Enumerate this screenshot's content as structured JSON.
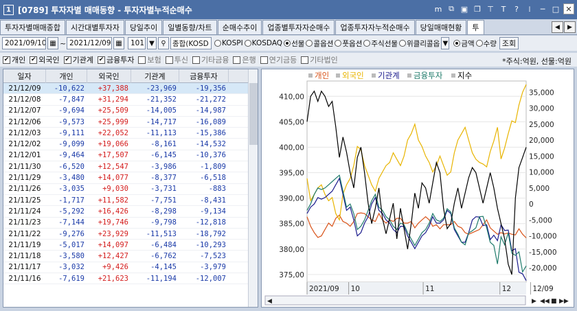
{
  "window": {
    "number": "1",
    "title": "[0789] 투자자별 매매동향 - 투자자별누적순매수"
  },
  "tabs": [
    "투자자별매매종합",
    "시간대별투자자",
    "당일추이",
    "일별동향/차트",
    "순매수추이",
    "업종별투자자순매수",
    "업종투자자누적순매수",
    "당일매매현황",
    "투"
  ],
  "toolbar": {
    "from_date": "2021/09/10",
    "to_date": "2021/12/09",
    "sep": "~",
    "code": "101",
    "market": "종합(KOSD",
    "options": [
      "KOSPI",
      "KOSDAQ",
      "선물",
      "콜옵션",
      "풋옵션",
      "주식선물",
      "위클리콜옵"
    ],
    "selected_option": "선물",
    "mode": [
      "금액",
      "수량"
    ],
    "selected_mode": "금액",
    "query_button": "조회"
  },
  "filters": [
    {
      "label": "개인",
      "checked": true
    },
    {
      "label": "외국인",
      "checked": true
    },
    {
      "label": "기관계",
      "checked": true
    },
    {
      "label": "금융투자",
      "checked": true
    },
    {
      "label": "보험",
      "checked": false
    },
    {
      "label": "투신",
      "checked": false
    },
    {
      "label": "기타금융",
      "checked": false
    },
    {
      "label": "은행",
      "checked": false
    },
    {
      "label": "연기금등",
      "checked": false
    },
    {
      "label": "기타법인",
      "checked": false
    }
  ],
  "unit_note": "*주식:억원, 선물:억원",
  "table": {
    "columns": [
      "일자",
      "개인",
      "외국인",
      "기관계",
      "금융투자"
    ],
    "rows": [
      [
        "21/12/09",
        "-10,622",
        "+37,388",
        "-23,969",
        "-19,356"
      ],
      [
        "21/12/08",
        "-7,847",
        "+31,294",
        "-21,352",
        "-21,272"
      ],
      [
        "21/12/07",
        "-9,694",
        "+25,509",
        "-14,005",
        "-14,987"
      ],
      [
        "21/12/06",
        "-9,573",
        "+25,999",
        "-14,717",
        "-16,089"
      ],
      [
        "21/12/03",
        "-9,111",
        "+22,052",
        "-11,113",
        "-15,386"
      ],
      [
        "21/12/02",
        "-9,099",
        "+19,066",
        "-8,161",
        "-14,532"
      ],
      [
        "21/12/01",
        "-9,464",
        "+17,507",
        "-6,145",
        "-10,376"
      ],
      [
        "21/11/30",
        "-6,520",
        "+12,547",
        "-3,986",
        "-1,809"
      ],
      [
        "21/11/29",
        "-3,480",
        "+14,077",
        "-8,377",
        "-6,518"
      ],
      [
        "21/11/26",
        "-3,035",
        "+9,030",
        "-3,731",
        "-883"
      ],
      [
        "21/11/25",
        "-1,717",
        "+11,582",
        "-7,751",
        "-8,431"
      ],
      [
        "21/11/24",
        "-5,292",
        "+16,426",
        "-8,298",
        "-9,134"
      ],
      [
        "21/11/23",
        "-7,144",
        "+19,746",
        "-9,798",
        "-12,818"
      ],
      [
        "21/11/22",
        "-9,276",
        "+23,929",
        "-11,513",
        "-18,792"
      ],
      [
        "21/11/19",
        "-5,017",
        "+14,097",
        "-6,484",
        "-10,293"
      ],
      [
        "21/11/18",
        "-3,580",
        "+12,427",
        "-6,762",
        "-7,523"
      ],
      [
        "21/11/17",
        "-3,032",
        "+9,426",
        "-4,145",
        "-3,979"
      ],
      [
        "21/11/16",
        "-7,619",
        "+21,623",
        "-11,194",
        "-12,007"
      ]
    ]
  },
  "chart_data": {
    "type": "line",
    "legend": [
      {
        "name": "개인",
        "color": "#d9541a"
      },
      {
        "name": "외국인",
        "color": "#e8b400"
      },
      {
        "name": "기관계",
        "color": "#1a1a8c"
      },
      {
        "name": "금융투자",
        "color": "#1e7a6a"
      },
      {
        "name": "지수",
        "color": "#000000"
      }
    ],
    "left_axis": {
      "ticks": [
        "410,00",
        "405,00",
        "400,00",
        "395,00",
        "390,00",
        "385,00",
        "380,00",
        "375,00"
      ],
      "range": [
        373.5,
        413
      ]
    },
    "right_axis": {
      "ticks": [
        "35,000",
        "30,000",
        "25,000",
        "20,000",
        "15,000",
        "10,000",
        "5,000",
        "0",
        "-5,000",
        "-10,000",
        "-15,000",
        "-20,000"
      ],
      "range": [
        -24500,
        38500
      ]
    },
    "x_labels": [
      "2021/09",
      "10",
      "11",
      "12",
      "12/09"
    ],
    "n_points": 62,
    "series_kospi200": [
      405,
      410,
      411,
      409,
      411,
      410,
      408,
      409,
      404,
      398,
      402,
      399,
      395,
      392,
      398,
      400,
      395,
      389,
      385,
      388,
      392,
      386,
      383,
      386,
      389,
      382,
      388,
      384,
      380,
      385,
      391,
      388,
      393,
      392,
      389,
      393,
      397,
      395,
      388,
      384,
      385,
      389,
      392,
      388,
      391,
      394,
      396,
      395,
      392,
      389,
      392,
      395,
      392,
      388,
      385,
      382,
      377,
      375,
      390,
      396,
      398,
      400
    ],
    "series_individual": [
      -4000,
      -7000,
      -9000,
      -10500,
      -10000,
      -8000,
      -6000,
      -7000,
      -4500,
      -3500,
      -5500,
      -6000,
      -7000,
      -5500,
      -3000,
      -2800,
      -3000,
      -4000,
      -5000,
      -5500,
      -3000,
      -5000,
      -6000,
      -5000,
      -5500,
      -4500,
      -4500,
      -6000,
      -6000,
      -5500,
      -7500,
      -6000,
      -5000,
      -4000,
      -5000,
      -7000,
      -6500,
      -7800,
      -6500,
      -6500,
      -6500,
      -5500,
      -7000,
      -7500,
      -9000,
      -9500,
      -9000,
      -8500,
      -8000,
      -6500,
      -5000,
      -7500,
      -8500,
      -9500,
      -9000,
      -9400,
      -9100,
      -9500,
      -9700,
      -7800,
      -9500,
      -10600
    ],
    "series_foreign": [
      8000,
      1000,
      3000,
      5000,
      6000,
      3000,
      1000,
      2000,
      -3000,
      -5000,
      3000,
      6000,
      8000,
      12000,
      18000,
      17000,
      12000,
      9000,
      6000,
      4000,
      8000,
      10000,
      12000,
      13000,
      16000,
      14000,
      12000,
      15000,
      20000,
      22000,
      25000,
      20000,
      18000,
      15000,
      13000,
      10000,
      12000,
      15000,
      12000,
      9000,
      10000,
      16000,
      20000,
      22000,
      24000,
      20000,
      16000,
      14000,
      13000,
      12500,
      11600,
      16400,
      19700,
      24000,
      14100,
      17500,
      22000,
      26000,
      25500,
      31000,
      35000,
      37400
    ],
    "series_institution": [
      -3000,
      -1000,
      0,
      2000,
      1500,
      2000,
      3000,
      4000,
      6000,
      8000,
      3000,
      -2000,
      -1000,
      -5000,
      -10000,
      -9000,
      -6000,
      -4000,
      0,
      2000,
      -2000,
      -3000,
      -5000,
      -6000,
      -8000,
      -9000,
      -7000,
      -7000,
      -10000,
      -12000,
      -14000,
      -12000,
      -10000,
      -9000,
      -7000,
      -4000,
      -6000,
      -6000,
      -5000,
      -2000,
      -3000,
      -8000,
      -10000,
      -12000,
      -12000,
      -9000,
      -5000,
      -4000,
      -4100,
      -6800,
      -6500,
      -11200,
      -9800,
      -11500,
      -6500,
      -8300,
      -8200,
      -14700,
      -14000,
      -21400,
      -21900,
      -24000
    ],
    "series_financial": [
      -2000,
      0,
      3000,
      5000,
      4500,
      5000,
      6000,
      7000,
      8000,
      9000,
      4000,
      -1000,
      0,
      -3000,
      -8000,
      -7000,
      -5000,
      -2000,
      1000,
      3000,
      -1000,
      -2000,
      -4000,
      -5000,
      -7000,
      -8000,
      -6000,
      -6500,
      -9000,
      -11000,
      -13000,
      -11000,
      -9000,
      -8000,
      -6000,
      -3000,
      -5000,
      -5500,
      -4500,
      -1500,
      -2500,
      -7500,
      -9500,
      -12000,
      -12800,
      -9100,
      -8400,
      -7500,
      -4000,
      -3900,
      -7500,
      -12000,
      -13000,
      -18800,
      -10300,
      -12800,
      -9100,
      -15400,
      -16100,
      -15000,
      -21300,
      -19400
    ]
  }
}
